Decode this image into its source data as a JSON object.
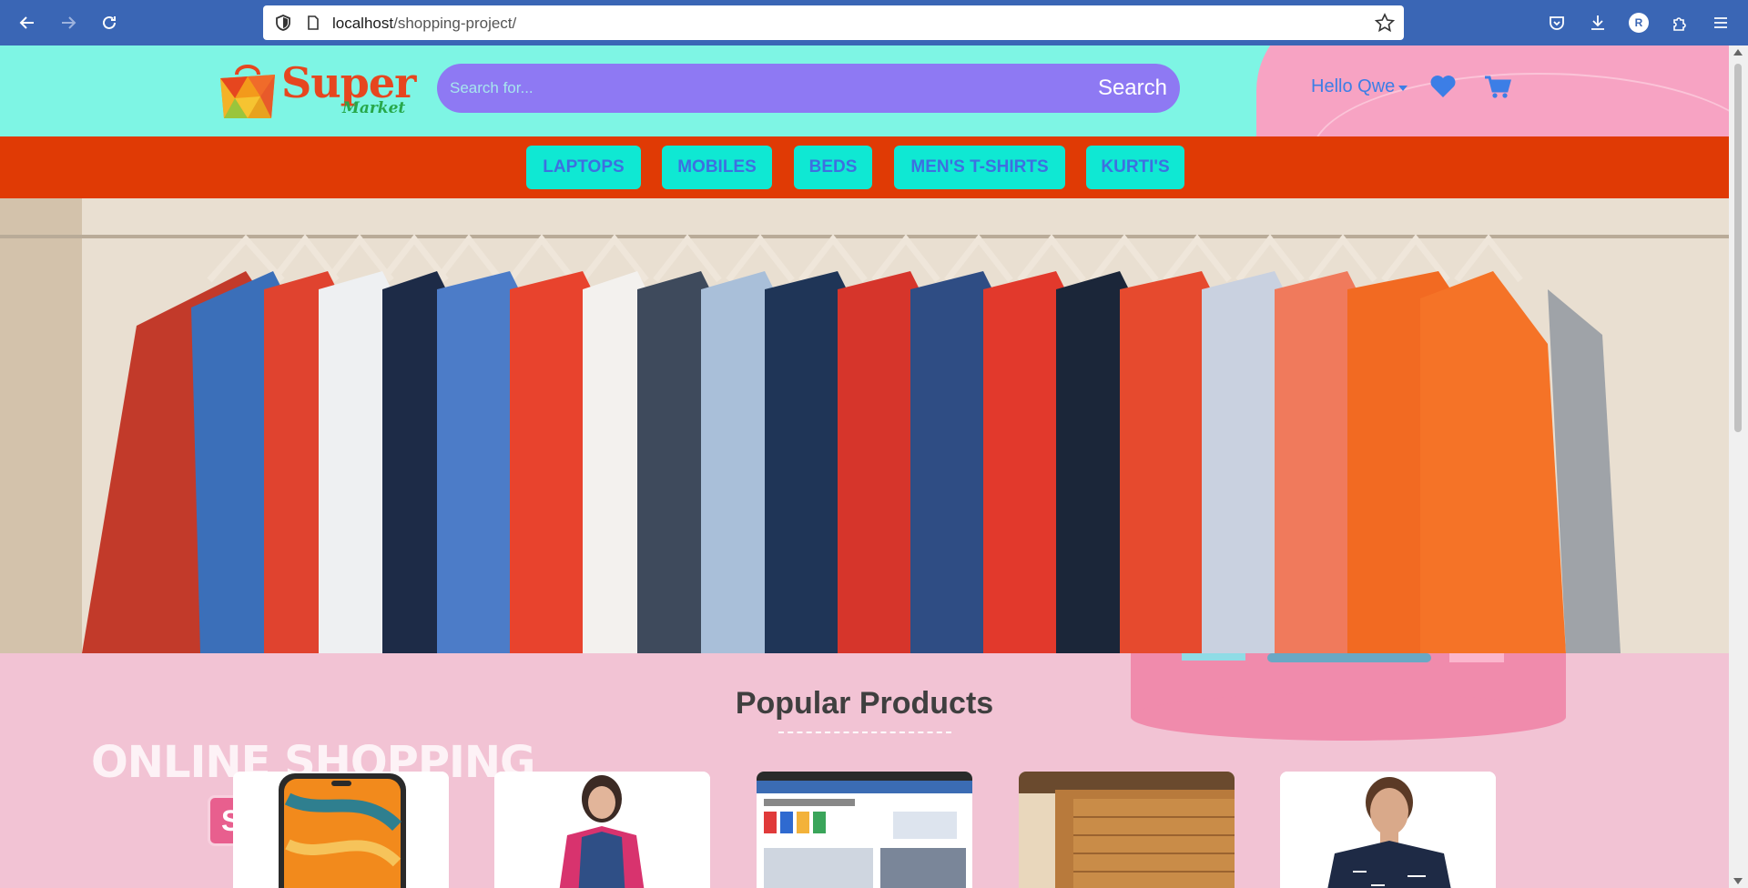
{
  "browser": {
    "url_host": "localhost",
    "url_path": "/shopping-project/",
    "profile_initial": "R",
    "icons": [
      "back-icon",
      "forward-icon",
      "reload-icon",
      "shield-icon",
      "page-icon",
      "star-icon",
      "pocket-icon",
      "download-icon",
      "extensions-icon",
      "menu-icon"
    ]
  },
  "header": {
    "logo_word": "Super",
    "logo_sub": "Market",
    "search_placeholder": "Search for...",
    "search_button": "Search",
    "user_greeting": "Hello Qwe",
    "icons": [
      "heart-icon",
      "cart-icon"
    ]
  },
  "categories": [
    "LAPTOPS",
    "MOBILES",
    "BEDS",
    "MEN'S T-SHIRTS",
    "KURTI'S"
  ],
  "banner": {
    "headline": "ONLINE SHOPPING",
    "badge_letter": "S"
  },
  "popular": {
    "title": "Popular Products",
    "products": [
      "smartphone",
      "kurti",
      "laptop-screen",
      "bed",
      "mens-sweatshirt"
    ]
  },
  "colors": {
    "chrome": "#3a66b5",
    "header_bg": "#7ef5e4",
    "search_bg": "#8e79f3",
    "nav_bg": "#e03a05",
    "nav_button": "#0fe8d3",
    "nav_text": "#3e6fe0",
    "page_bg": "#f2c3d4"
  }
}
